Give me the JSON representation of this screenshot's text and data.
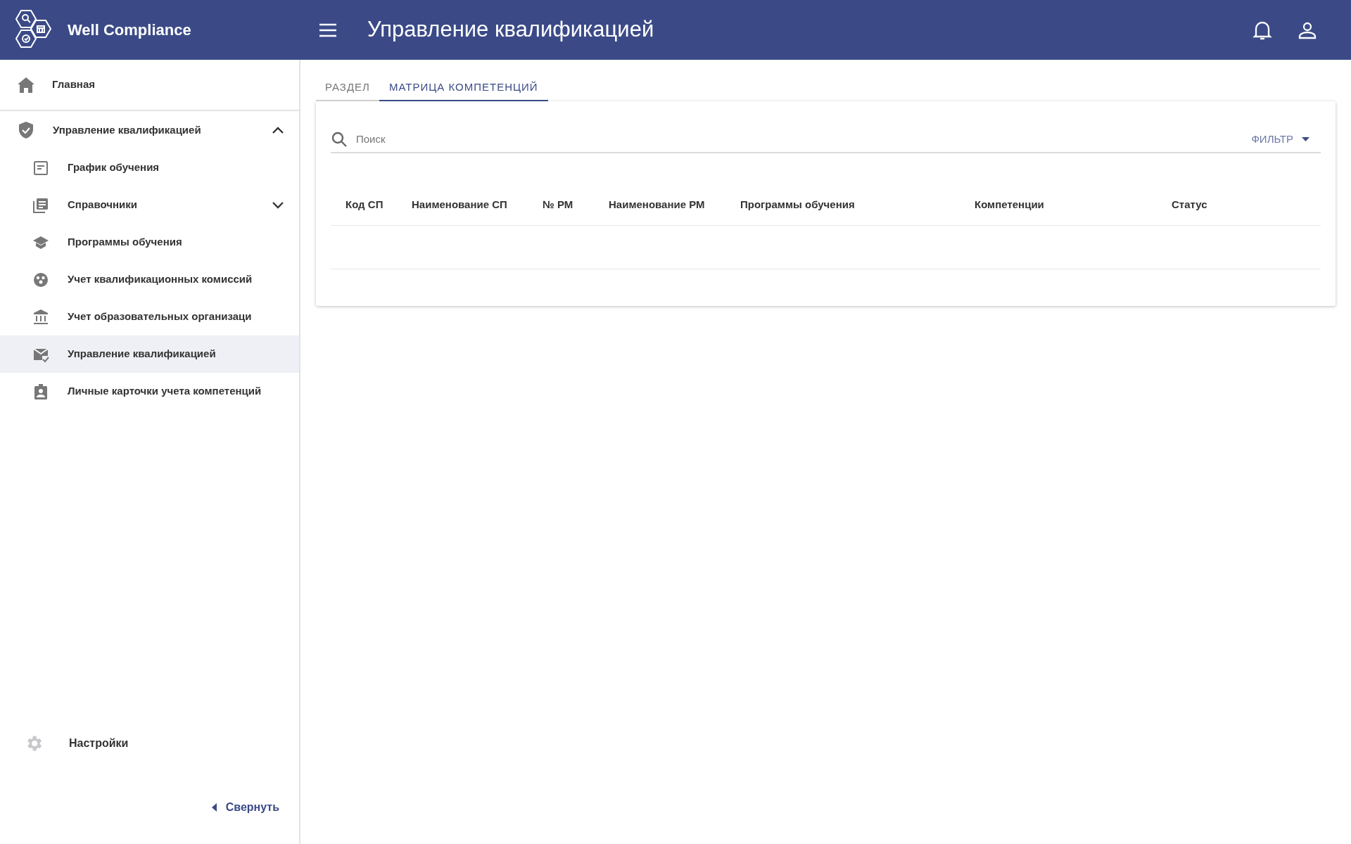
{
  "app": {
    "name": "Well Compliance"
  },
  "header": {
    "title": "Управление квалификацией"
  },
  "sidebar": {
    "home": {
      "label": "Главная",
      "selected": false
    },
    "section": {
      "label": "Управление квалификацией",
      "expanded": true,
      "children": [
        {
          "kind": "link",
          "label": "График обучения",
          "selected": false
        },
        {
          "kind": "group",
          "label": "Справочники",
          "selected": false,
          "expanded": false
        },
        {
          "kind": "link",
          "label": "Программы обучения",
          "selected": false
        },
        {
          "kind": "link",
          "label": "Учет квалификационных комиссий",
          "selected": false
        },
        {
          "kind": "link",
          "label": "Учет образовательных организаци",
          "selected": false
        },
        {
          "kind": "link",
          "label": "Управление квалификацией",
          "selected": true
        },
        {
          "kind": "link",
          "label": "Личные карточки учета компетенций",
          "selected": false
        }
      ]
    },
    "settings": "Настройки",
    "collapse": "Свернуть"
  },
  "tabs": [
    {
      "label": "РАЗДЕЛ",
      "selected": false
    },
    {
      "label": "МАТРИЦА КОМПЕТЕНЦИЙ",
      "selected": true
    }
  ],
  "search": {
    "placeholder": "Поиск"
  },
  "filter": "ФИЛЬТР",
  "table": {
    "columns": [
      "Код СП",
      "Наименование СП",
      "№ РМ",
      "Наименование РМ",
      "Программы обучения",
      "Компетенции",
      "Статус"
    ]
  }
}
